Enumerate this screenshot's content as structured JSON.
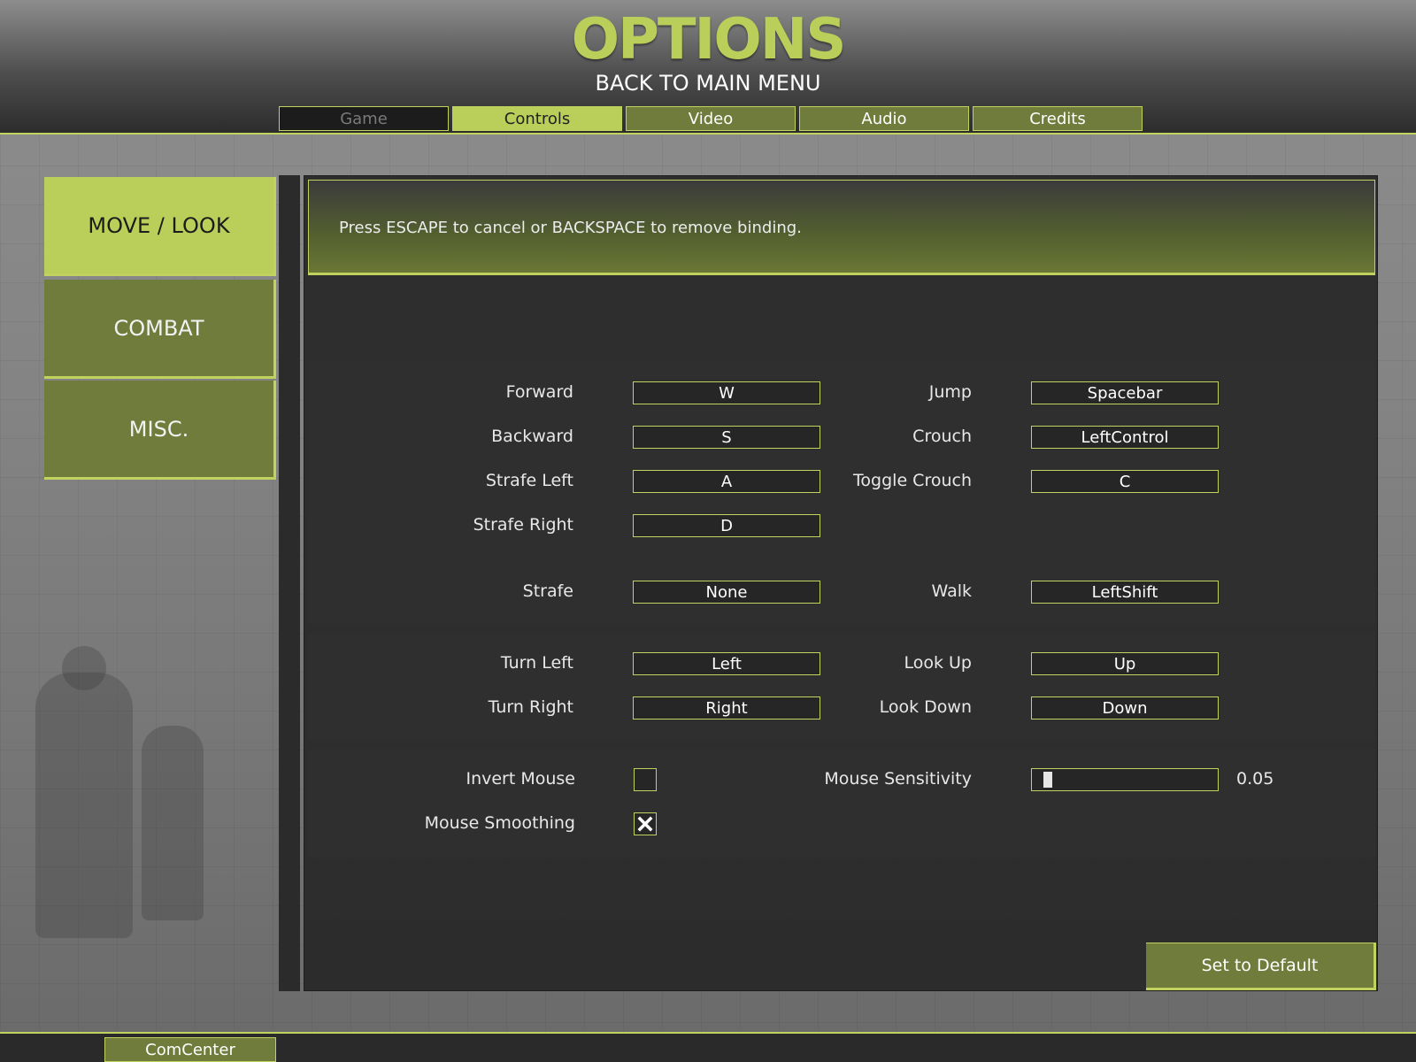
{
  "header": {
    "title": "OPTIONS",
    "back_label": "BACK TO MAIN MENU",
    "tabs": [
      {
        "label": "Game",
        "state": "disabled"
      },
      {
        "label": "Controls",
        "state": "active"
      },
      {
        "label": "Video",
        "state": "normal"
      },
      {
        "label": "Audio",
        "state": "normal"
      },
      {
        "label": "Credits",
        "state": "normal"
      }
    ]
  },
  "categories": [
    {
      "label": "MOVE / LOOK",
      "active": true
    },
    {
      "label": "COMBAT",
      "active": false
    },
    {
      "label": "MISC.",
      "active": false
    }
  ],
  "notice": "Press ESCAPE to cancel or BACKSPACE to remove binding.",
  "bindings": {
    "movement": [
      {
        "label": "Forward",
        "key": "W"
      },
      {
        "label": "Backward",
        "key": "S"
      },
      {
        "label": "Strafe Left",
        "key": "A"
      },
      {
        "label": "Strafe Right",
        "key": "D"
      },
      {
        "label": "Strafe",
        "key": "None"
      }
    ],
    "movement_right": [
      {
        "label": "Jump",
        "key": "Spacebar"
      },
      {
        "label": "Crouch",
        "key": "LeftControl"
      },
      {
        "label": "Toggle Crouch",
        "key": "C"
      },
      {
        "label": "Walk",
        "key": "LeftShift"
      }
    ],
    "turning": [
      {
        "label": "Turn Left",
        "key": "Left"
      },
      {
        "label": "Turn Right",
        "key": "Right"
      }
    ],
    "looking": [
      {
        "label": "Look Up",
        "key": "Up"
      },
      {
        "label": "Look Down",
        "key": "Down"
      }
    ]
  },
  "mouse": {
    "invert_label": "Invert Mouse",
    "invert_checked": false,
    "smoothing_label": "Mouse Smoothing",
    "smoothing_checked": true,
    "sensitivity_label": "Mouse Sensitivity",
    "sensitivity_value": "0.05",
    "sensitivity_fraction": 0.05
  },
  "default_button": "Set to Default",
  "footer": {
    "comcenter_label": "ComCenter"
  },
  "colors": {
    "accent": "#bacf5a",
    "button": "#6f7c3b",
    "border": "#c1d35e"
  }
}
